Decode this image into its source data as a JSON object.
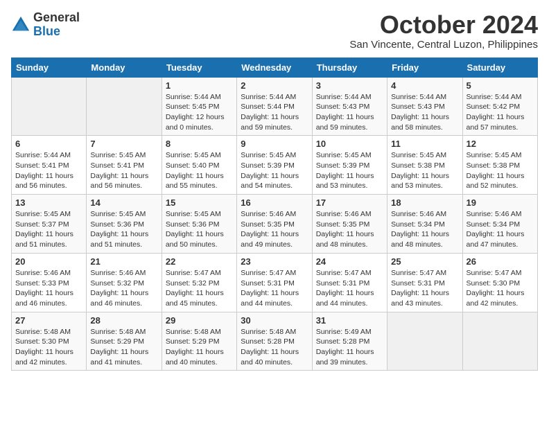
{
  "header": {
    "logo_line1": "General",
    "logo_line2": "Blue",
    "month_title": "October 2024",
    "subtitle": "San Vincente, Central Luzon, Philippines"
  },
  "weekdays": [
    "Sunday",
    "Monday",
    "Tuesday",
    "Wednesday",
    "Thursday",
    "Friday",
    "Saturday"
  ],
  "weeks": [
    [
      {
        "day": "",
        "info": ""
      },
      {
        "day": "",
        "info": ""
      },
      {
        "day": "1",
        "info": "Sunrise: 5:44 AM\nSunset: 5:45 PM\nDaylight: 12 hours\nand 0 minutes."
      },
      {
        "day": "2",
        "info": "Sunrise: 5:44 AM\nSunset: 5:44 PM\nDaylight: 11 hours\nand 59 minutes."
      },
      {
        "day": "3",
        "info": "Sunrise: 5:44 AM\nSunset: 5:43 PM\nDaylight: 11 hours\nand 59 minutes."
      },
      {
        "day": "4",
        "info": "Sunrise: 5:44 AM\nSunset: 5:43 PM\nDaylight: 11 hours\nand 58 minutes."
      },
      {
        "day": "5",
        "info": "Sunrise: 5:44 AM\nSunset: 5:42 PM\nDaylight: 11 hours\nand 57 minutes."
      }
    ],
    [
      {
        "day": "6",
        "info": "Sunrise: 5:44 AM\nSunset: 5:41 PM\nDaylight: 11 hours\nand 56 minutes."
      },
      {
        "day": "7",
        "info": "Sunrise: 5:45 AM\nSunset: 5:41 PM\nDaylight: 11 hours\nand 56 minutes."
      },
      {
        "day": "8",
        "info": "Sunrise: 5:45 AM\nSunset: 5:40 PM\nDaylight: 11 hours\nand 55 minutes."
      },
      {
        "day": "9",
        "info": "Sunrise: 5:45 AM\nSunset: 5:39 PM\nDaylight: 11 hours\nand 54 minutes."
      },
      {
        "day": "10",
        "info": "Sunrise: 5:45 AM\nSunset: 5:39 PM\nDaylight: 11 hours\nand 53 minutes."
      },
      {
        "day": "11",
        "info": "Sunrise: 5:45 AM\nSunset: 5:38 PM\nDaylight: 11 hours\nand 53 minutes."
      },
      {
        "day": "12",
        "info": "Sunrise: 5:45 AM\nSunset: 5:38 PM\nDaylight: 11 hours\nand 52 minutes."
      }
    ],
    [
      {
        "day": "13",
        "info": "Sunrise: 5:45 AM\nSunset: 5:37 PM\nDaylight: 11 hours\nand 51 minutes."
      },
      {
        "day": "14",
        "info": "Sunrise: 5:45 AM\nSunset: 5:36 PM\nDaylight: 11 hours\nand 51 minutes."
      },
      {
        "day": "15",
        "info": "Sunrise: 5:45 AM\nSunset: 5:36 PM\nDaylight: 11 hours\nand 50 minutes."
      },
      {
        "day": "16",
        "info": "Sunrise: 5:46 AM\nSunset: 5:35 PM\nDaylight: 11 hours\nand 49 minutes."
      },
      {
        "day": "17",
        "info": "Sunrise: 5:46 AM\nSunset: 5:35 PM\nDaylight: 11 hours\nand 48 minutes."
      },
      {
        "day": "18",
        "info": "Sunrise: 5:46 AM\nSunset: 5:34 PM\nDaylight: 11 hours\nand 48 minutes."
      },
      {
        "day": "19",
        "info": "Sunrise: 5:46 AM\nSunset: 5:34 PM\nDaylight: 11 hours\nand 47 minutes."
      }
    ],
    [
      {
        "day": "20",
        "info": "Sunrise: 5:46 AM\nSunset: 5:33 PM\nDaylight: 11 hours\nand 46 minutes."
      },
      {
        "day": "21",
        "info": "Sunrise: 5:46 AM\nSunset: 5:32 PM\nDaylight: 11 hours\nand 46 minutes."
      },
      {
        "day": "22",
        "info": "Sunrise: 5:47 AM\nSunset: 5:32 PM\nDaylight: 11 hours\nand 45 minutes."
      },
      {
        "day": "23",
        "info": "Sunrise: 5:47 AM\nSunset: 5:31 PM\nDaylight: 11 hours\nand 44 minutes."
      },
      {
        "day": "24",
        "info": "Sunrise: 5:47 AM\nSunset: 5:31 PM\nDaylight: 11 hours\nand 44 minutes."
      },
      {
        "day": "25",
        "info": "Sunrise: 5:47 AM\nSunset: 5:31 PM\nDaylight: 11 hours\nand 43 minutes."
      },
      {
        "day": "26",
        "info": "Sunrise: 5:47 AM\nSunset: 5:30 PM\nDaylight: 11 hours\nand 42 minutes."
      }
    ],
    [
      {
        "day": "27",
        "info": "Sunrise: 5:48 AM\nSunset: 5:30 PM\nDaylight: 11 hours\nand 42 minutes."
      },
      {
        "day": "28",
        "info": "Sunrise: 5:48 AM\nSunset: 5:29 PM\nDaylight: 11 hours\nand 41 minutes."
      },
      {
        "day": "29",
        "info": "Sunrise: 5:48 AM\nSunset: 5:29 PM\nDaylight: 11 hours\nand 40 minutes."
      },
      {
        "day": "30",
        "info": "Sunrise: 5:48 AM\nSunset: 5:28 PM\nDaylight: 11 hours\nand 40 minutes."
      },
      {
        "day": "31",
        "info": "Sunrise: 5:49 AM\nSunset: 5:28 PM\nDaylight: 11 hours\nand 39 minutes."
      },
      {
        "day": "",
        "info": ""
      },
      {
        "day": "",
        "info": ""
      }
    ]
  ]
}
